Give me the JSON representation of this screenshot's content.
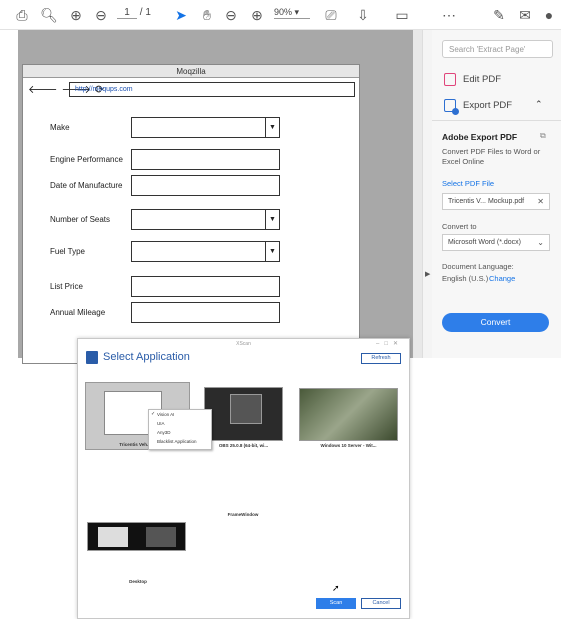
{
  "toolbar": {
    "page_current": "1",
    "page_total": "/ 1",
    "zoom": "90%"
  },
  "mockup": {
    "window_title": "Moqzilla",
    "url": "http://moqups.com",
    "fields": [
      {
        "label": "Make"
      },
      {
        "label": "Engine Performance"
      },
      {
        "label": "Date of Manufacture"
      },
      {
        "label": "Number of Seats"
      },
      {
        "label": "Fuel Type"
      },
      {
        "label": "List Price"
      },
      {
        "label": "Annual Mileage"
      }
    ]
  },
  "panel": {
    "search_placeholder": "Search 'Extract Page'",
    "edit_pdf": "Edit PDF",
    "export_pdf": "Export PDF",
    "heading": "Adobe Export PDF",
    "description": "Convert PDF Files to Word or Excel Online",
    "select_file_link": "Select PDF File",
    "file_name": "Tricentis V... Mockup.pdf",
    "convert_to_label": "Convert to",
    "convert_to_value": "Microsoft Word (*.docx)",
    "doc_language_label": "Document Language:",
    "doc_language_value": "English (U.S.)",
    "change_link": "Change",
    "convert_button": "Convert"
  },
  "dialog": {
    "window_title": "XScan",
    "title": "Select Application",
    "refresh": "Refresh",
    "thumbnails": [
      {
        "label": "Tricentis Veh..."
      },
      {
        "label": "OBS 25.0.8 (64-bit, wi..."
      },
      {
        "label": "Windows 10 Server - Wit..."
      },
      {
        "label": "FrameWindow"
      },
      {
        "label": "Desktop"
      }
    ],
    "context_menu": [
      "Vision AI",
      "UIA",
      "Any3D",
      "Blacklist Application"
    ],
    "scan": "Scan",
    "cancel": "Cancel"
  },
  "colors": {
    "accent": "#1473e6",
    "dialog_blue": "#2a5ca8"
  }
}
